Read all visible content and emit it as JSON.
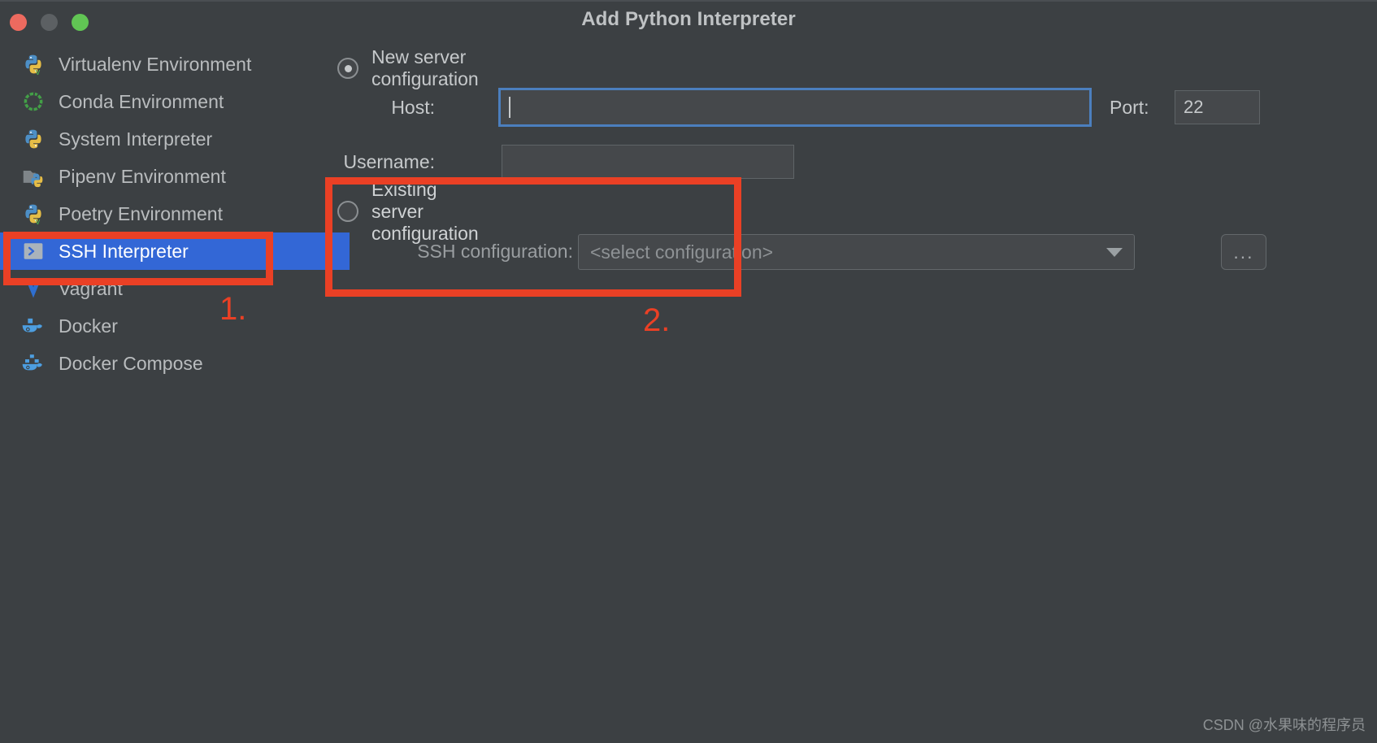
{
  "window": {
    "title": "Add Python Interpreter",
    "controls": [
      "close",
      "minimize",
      "zoom"
    ]
  },
  "sidebar": {
    "items": [
      {
        "label": "Virtualenv Environment",
        "icon": "python-venv-icon",
        "selected": false
      },
      {
        "label": "Conda Environment",
        "icon": "conda-icon",
        "selected": false
      },
      {
        "label": "System Interpreter",
        "icon": "python-icon",
        "selected": false
      },
      {
        "label": "Pipenv Environment",
        "icon": "pipenv-icon",
        "selected": false
      },
      {
        "label": "Poetry Environment",
        "icon": "poetry-icon",
        "selected": false
      },
      {
        "label": "SSH Interpreter",
        "icon": "ssh-terminal-icon",
        "selected": true
      },
      {
        "label": "Vagrant",
        "icon": "vagrant-icon",
        "selected": false
      },
      {
        "label": "Docker",
        "icon": "docker-icon",
        "selected": false
      },
      {
        "label": "Docker Compose",
        "icon": "docker-compose-icon",
        "selected": false
      }
    ]
  },
  "main": {
    "new_server": {
      "radio_label": "New server configuration",
      "selected": true,
      "host_label": "Host:",
      "host_value": "",
      "port_label": "Port:",
      "port_value": "22",
      "username_label": "Username:",
      "username_value": ""
    },
    "existing_server": {
      "radio_label": "Existing server configuration",
      "selected": false,
      "ssh_config_label": "SSH configuration:",
      "ssh_config_value": "<select configuration>",
      "browse_button_label": "..."
    }
  },
  "annotations": {
    "marker_one": "1.",
    "marker_two": "2.",
    "color": "#ea4025"
  },
  "watermark": {
    "text": "CSDN @水果味的程序员"
  },
  "colors": {
    "background": "#3c4043",
    "selection": "#3367d6",
    "accent_red": "#ea4025",
    "focus_border": "#4b7fbe"
  }
}
